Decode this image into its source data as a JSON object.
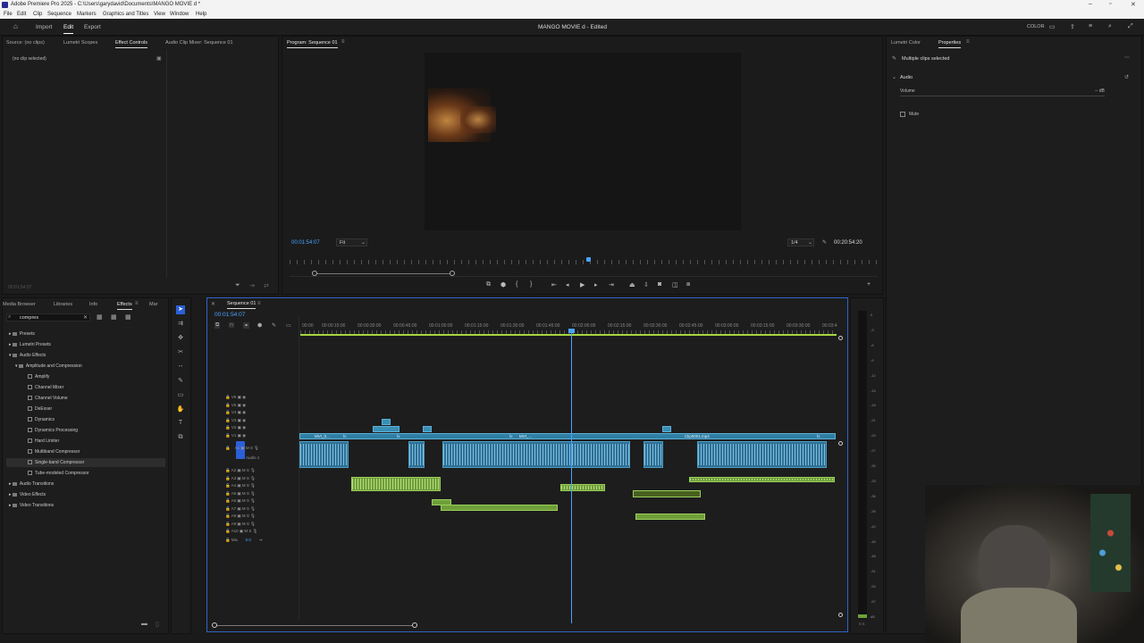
{
  "app": {
    "title": "Adobe Premiere Pro 2025 - C:\\Users\\garydavid\\Documents\\MANGO MOVIE d *",
    "doc_title": "MANGO MOVIE d - Edited"
  },
  "menu": [
    "File",
    "Edit",
    "Clip",
    "Sequence",
    "Markers",
    "Graphics and Titles",
    "View",
    "Window",
    "Help"
  ],
  "workspace": {
    "import": "Import",
    "edit": "Edit",
    "export": "Export",
    "color": "COLOR"
  },
  "source_panel": {
    "tabs": [
      "Source: (no clips)",
      "Lumetri Scopes",
      "Effect Controls",
      "Audio Clip Mixer: Sequence 01"
    ],
    "message": "(no clip selected)",
    "timecode": "00:01:54:07"
  },
  "program": {
    "tab": "Program: Sequence 01",
    "timecode": "00:01:54:07",
    "fit": "Fit",
    "quality": "1/4",
    "duration": "00:20:54:20"
  },
  "properties": {
    "tabs": [
      "Lumetri Color",
      "Properties"
    ],
    "header": "Multiple clips selected",
    "section": "Audio",
    "volume_label": "Volume",
    "volume_value": "-- dB",
    "mute_label": "Mute"
  },
  "project": {
    "tabs": [
      "Media Browser",
      "Libraries",
      "Info",
      "Effects",
      "Mar"
    ],
    "search": "compres",
    "tree": [
      "Presets",
      "Lumetri Presets",
      "Audio Effects",
      "Amplitude and Compression",
      "Amplify",
      "Channel Mixer",
      "Channel Volume",
      "DeEsser",
      "Dynamics",
      "Dynamics Processing",
      "Hard Limiter",
      "Multiband Compressor",
      "Single-band Compressor",
      "Tube-modeled Compressor",
      "Audio Transitions",
      "Video Effects",
      "Video Transitions"
    ]
  },
  "timeline": {
    "tab": "Sequence 01",
    "timecode": "00:01:54:07",
    "ruler": [
      "00:00",
      "00:00:15:00",
      "00:00:30:00",
      "00:00:45:00",
      "00:01:00:00",
      "00:01:15:00",
      "00:01:30:00",
      "00:01:45:00",
      "00:02:00:00",
      "00:02:15:00",
      "00:02:30:00",
      "00:02:45:00",
      "00:03:00:00",
      "00:03:15:00",
      "00:03:30:00",
      "00:03:4"
    ],
    "video_tracks": [
      "V6",
      "V5",
      "V4",
      "V3",
      "V2",
      "V1"
    ],
    "audio_tracks": [
      "A1",
      "A2",
      "A3",
      "A4",
      "A5",
      "A6",
      "A7",
      "A8",
      "A9",
      "A10"
    ],
    "audio1_name": "Audio 1",
    "mix_label": "Mix",
    "mix_value": "0.0",
    "clip_names": [
      "MVI_0...",
      "MVI_...",
      "Clip0001.mp4"
    ],
    "fx": "fx"
  },
  "meter_labels": [
    "0",
    "-3",
    "-6",
    "-9",
    "-12",
    "-15",
    "-18",
    "-21",
    "-24",
    "-27",
    "-30",
    "-33",
    "-36",
    "-39",
    "-42",
    "-45",
    "-48",
    "-51",
    "-54",
    "-57",
    "dB"
  ],
  "meter_footer": "S  S"
}
